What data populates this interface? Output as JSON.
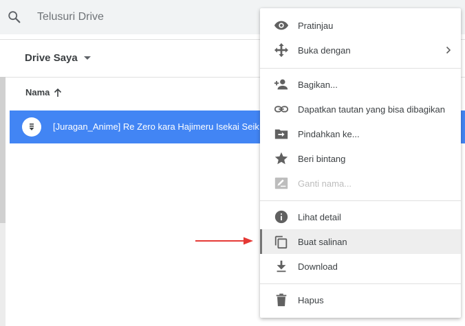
{
  "search": {
    "placeholder": "Telusuri Drive",
    "icon": "search-icon"
  },
  "breadcrumb": {
    "label": "Drive Saya",
    "icon": "caret-down-icon"
  },
  "file_list": {
    "column_header": "Nama",
    "sort_icon": "arrow-up-icon",
    "selected_file": {
      "name": "[Juragan_Anime] Re Zero kara Hajimeru Isekai Seikatsu",
      "icon": "file-icon"
    }
  },
  "context_menu": {
    "items": [
      {
        "label": "Pratinjau",
        "icon": "eye-icon"
      },
      {
        "label": "Buka dengan",
        "icon": "move-arrows-icon",
        "submenu": true
      },
      {
        "label": "Bagikan...",
        "icon": "person-add-icon"
      },
      {
        "label": "Dapatkan tautan yang bisa dibagikan",
        "icon": "link-icon"
      },
      {
        "label": "Pindahkan ke...",
        "icon": "folder-move-icon"
      },
      {
        "label": "Beri bintang",
        "icon": "star-icon"
      },
      {
        "label": "Ganti nama...",
        "icon": "rename-icon",
        "disabled": true
      },
      {
        "label": "Lihat detail",
        "icon": "info-icon"
      },
      {
        "label": "Buat salinan",
        "icon": "copy-icon",
        "highlighted": true
      },
      {
        "label": "Download",
        "icon": "download-icon"
      },
      {
        "label": "Hapus",
        "icon": "trash-icon"
      }
    ]
  },
  "colors": {
    "selection": "#4285f4",
    "annotation_arrow": "#e53935",
    "icon_gray": "#616161"
  }
}
